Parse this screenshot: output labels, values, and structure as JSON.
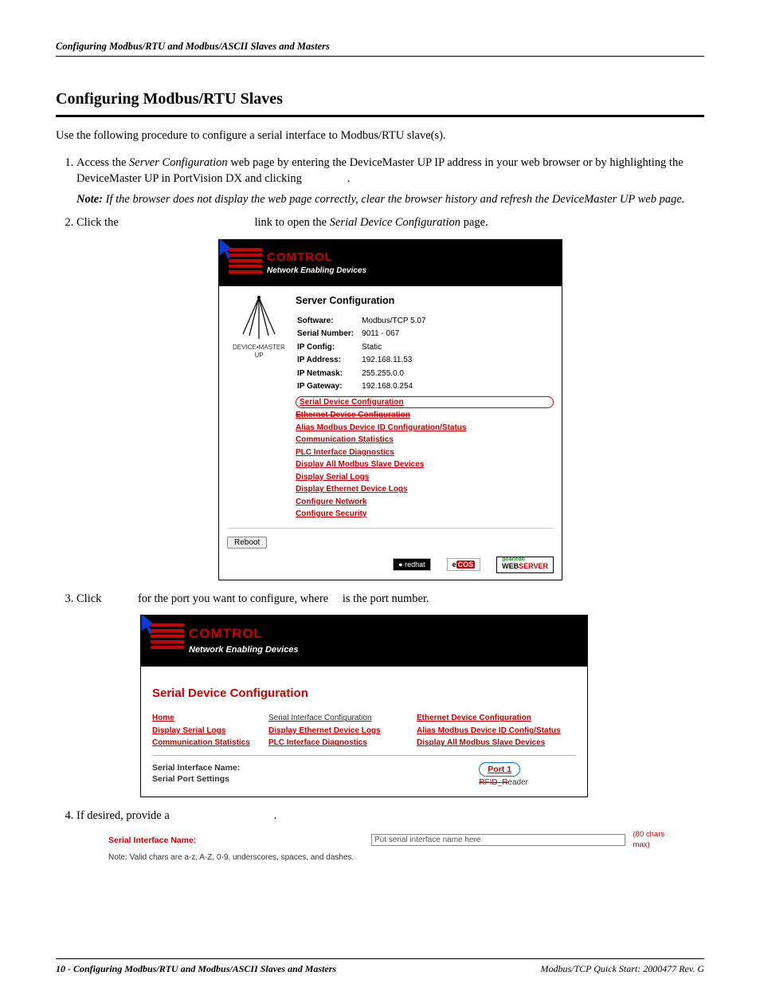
{
  "header": "Configuring Modbus/RTU and Modbus/ASCII Slaves and Masters",
  "section_title": "Configuring Modbus/RTU Slaves",
  "intro": "Use the following procedure to configure a serial interface to Modbus/RTU slave(s).",
  "steps": {
    "s1": {
      "pre": "Access the ",
      "em": "Server Configuration",
      "post": " web page by entering the DeviceMaster UP IP address in your web browser or by highlighting the DeviceMaster UP in PortVision DX and clicking ",
      "tail": "."
    },
    "note": {
      "label": "Note:",
      "body": "If the browser does not display the web page correctly, clear the browser history and refresh the DeviceMaster UP web page."
    },
    "s2": {
      "pre": "Click the ",
      "mid": " link to open the ",
      "em": "Serial Device Configuration",
      "post": " page."
    },
    "s3": {
      "pre": "Click ",
      "mid": " for the port you want to configure, where ",
      "post": " is the port number."
    },
    "s4": {
      "pre": "If desired, provide a ",
      "post": "."
    }
  },
  "fig1": {
    "brand": "COMTROL",
    "brand_sub": "Network Enabling Devices",
    "dm_label": "DEVICE•MASTER",
    "dm_sub": "UP",
    "title": "Server Configuration",
    "rows": [
      [
        "Software:",
        "Modbus/TCP 5.07"
      ],
      [
        "Serial Number:",
        "9011 - 067"
      ],
      [
        "IP Config:",
        "Static"
      ],
      [
        "IP Address:",
        "192.168.11.53"
      ],
      [
        "IP Netmask:",
        "255.255.0.0"
      ],
      [
        "IP Gateway:",
        "192.168.0.254"
      ]
    ],
    "links": [
      "Serial Device Configuration",
      "Ethernet Device Configuration",
      "Alias Modbus Device ID Configuration/Status",
      "Communication Statistics",
      "PLC Interface Diagnostics",
      "Display All Modbus Slave Devices",
      "Display Serial Logs",
      "Display Ethernet Device Logs",
      "Configure Network",
      "Configure Security"
    ],
    "reboot": "Reboot",
    "logos": {
      "redhat": "redhat",
      "ecos_e": "e",
      "ecos_cos": "COS",
      "web": "WEB",
      "server": "SERVER",
      "gh": "goahead"
    }
  },
  "fig2": {
    "brand": "COMTROL",
    "brand_sub": "Network Enabling Devices",
    "title": "Serial Device Configuration",
    "grid": [
      [
        "Home",
        "Serial Interface Configuration",
        "Ethernet Device Configuration"
      ],
      [
        "Display Serial Logs",
        "Display Ethernet Device Logs",
        "Alias Modbus Device ID Config/Status"
      ],
      [
        "Communication Statistics",
        "PLC Interface Diagnostics",
        "Display All Modbus Slave Devices"
      ]
    ],
    "port_label1": "Serial Interface Name:",
    "port_label2": "Serial Port Settings",
    "port_link": "Port 1",
    "rfid": "RFID_R",
    "reader": "eader"
  },
  "sif": {
    "label": "Serial Interface Name:",
    "placeholder": "Put serial interface name here",
    "max": "(80 chars max)",
    "note": "Note: Valid chars are a-z, A-Z, 0-9, underscores, spaces, and dashes."
  },
  "footer": {
    "left_num": "10 - ",
    "left": "Configuring Modbus/RTU and Modbus/ASCII Slaves and Masters",
    "right_em": "Modbus/TCP Quick Start",
    "right": ": 2000477 Rev. G"
  }
}
